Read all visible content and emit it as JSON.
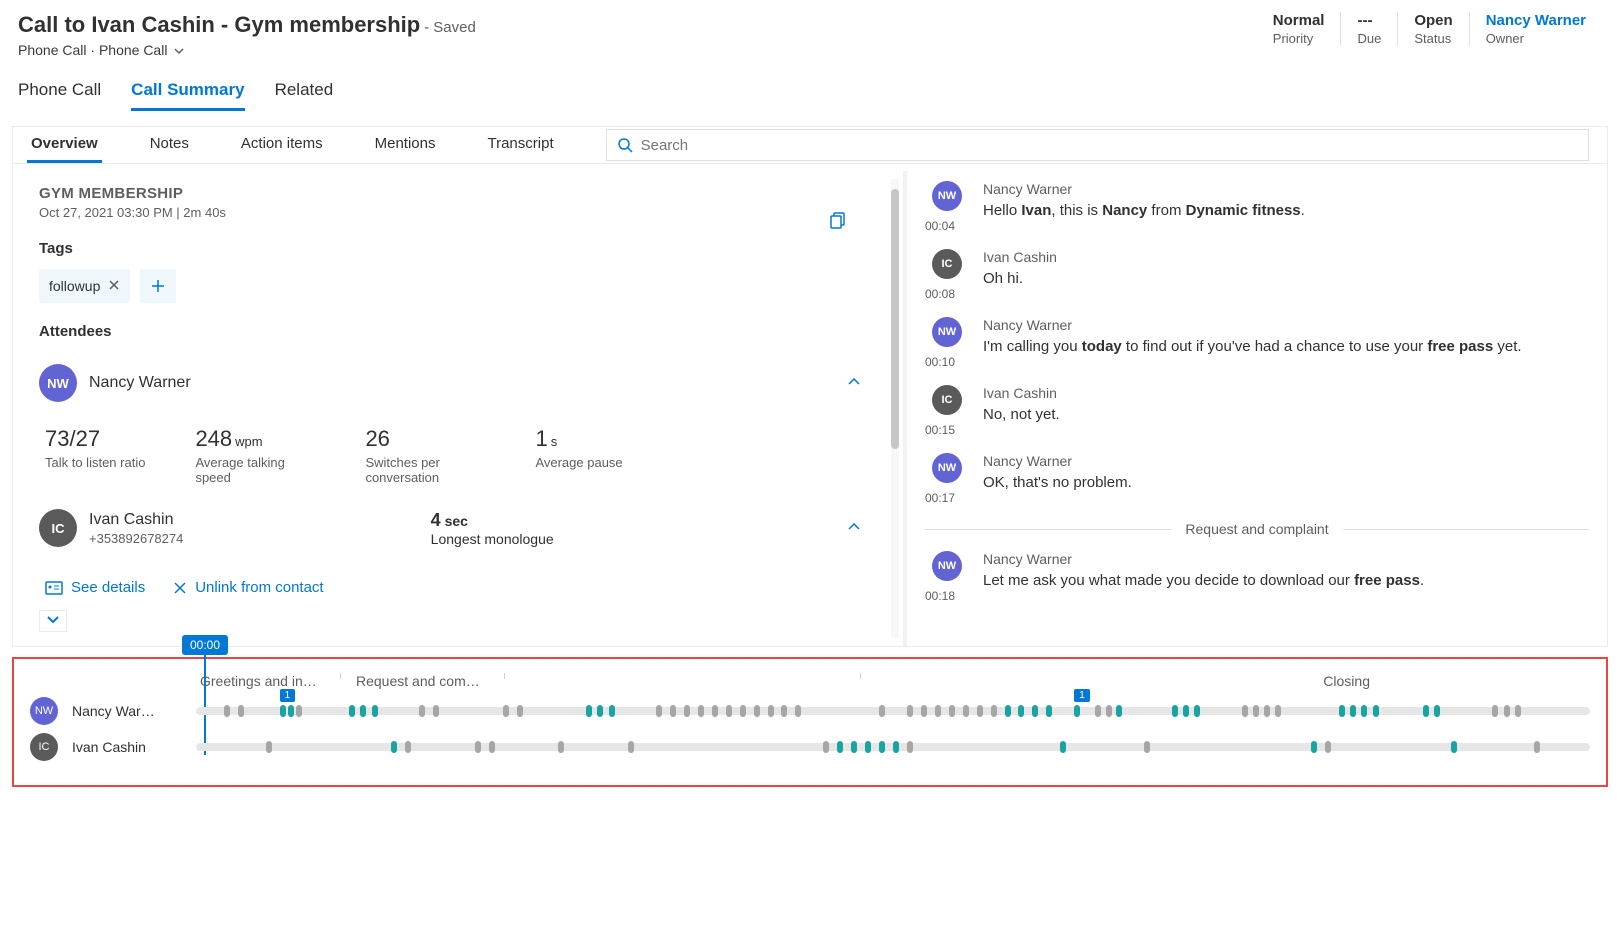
{
  "header": {
    "title": "Call to Ivan Cashin - Gym membership",
    "saved": "- Saved",
    "subtitle1": "Phone Call",
    "subtitle_sep": "·",
    "subtitle2": "Phone Call"
  },
  "meta": {
    "priority": {
      "value": "Normal",
      "label": "Priority"
    },
    "due": {
      "value": "---",
      "label": "Due"
    },
    "status": {
      "value": "Open",
      "label": "Status"
    },
    "owner": {
      "value": "Nancy Warner",
      "label": "Owner"
    }
  },
  "mainTabs": {
    "t1": "Phone Call",
    "t2": "Call Summary",
    "t3": "Related"
  },
  "subTabs": {
    "t1": "Overview",
    "t2": "Notes",
    "t3": "Action items",
    "t4": "Mentions"
  },
  "overview": {
    "title": "GYM MEMBERSHIP",
    "subtitle": "Oct 27, 2021 03:30 PM  |  2m 40s",
    "tagsLabel": "Tags",
    "tag1": "followup",
    "attendeesLabel": "Attendees",
    "a1": {
      "initials": "NW",
      "name": "Nancy Warner"
    },
    "a2": {
      "initials": "IC",
      "name": "Ivan Cashin",
      "phone": "+353892678274"
    },
    "stats": {
      "ratio": {
        "n": "73/27",
        "d": "Talk to listen ratio"
      },
      "wpm": {
        "n": "248",
        "u": "wpm",
        "d": "Average talking speed"
      },
      "sw": {
        "n": "26",
        "d": "Switches per conversation"
      },
      "pause": {
        "n": "1",
        "u": "s",
        "d": "Average pause"
      },
      "mono": {
        "n": "4",
        "u": "sec",
        "d": "Longest monologue"
      }
    },
    "actions": {
      "details": "See details",
      "unlink": "Unlink from contact"
    }
  },
  "transcript": {
    "label": "Transcript",
    "searchPlaceholder": "Search",
    "divider": "Request and complaint",
    "m1": {
      "init": "NW",
      "speaker": "Nancy Warner",
      "ts": "00:04",
      "pre": "Hello ",
      "b1": "Ivan",
      "mid1": ", this is ",
      "b2": "Nancy",
      "mid2": " from ",
      "b3": "Dynamic fitness",
      "post": "."
    },
    "m2": {
      "init": "IC",
      "speaker": "Ivan Cashin",
      "ts": "00:08",
      "text": "Oh hi."
    },
    "m3": {
      "init": "NW",
      "speaker": "Nancy Warner",
      "ts": "00:10",
      "pre": "I'm calling you ",
      "b1": "today",
      "mid": " to find out if you've had a chance to use your ",
      "b2": "free pass",
      "post": " yet."
    },
    "m4": {
      "init": "IC",
      "speaker": "Ivan Cashin",
      "ts": "00:15",
      "text": "No, not yet."
    },
    "m5": {
      "init": "NW",
      "speaker": "Nancy Warner",
      "ts": "00:17",
      "text": "OK, that's no problem."
    },
    "m6": {
      "init": "NW",
      "speaker": "Nancy Warner",
      "ts": "00:18",
      "pre": "Let me ask you what made you decide to download our ",
      "b1": "free pass",
      "post": "."
    }
  },
  "timeline": {
    "cursor": "00:00",
    "marker": "1",
    "seg1": "Greetings and in…",
    "seg2": "Request and com…",
    "seg3": "Closing",
    "r1": {
      "init": "NW",
      "name": "Nancy War…"
    },
    "r2": {
      "init": "IC",
      "name": "Ivan Cashin"
    }
  }
}
